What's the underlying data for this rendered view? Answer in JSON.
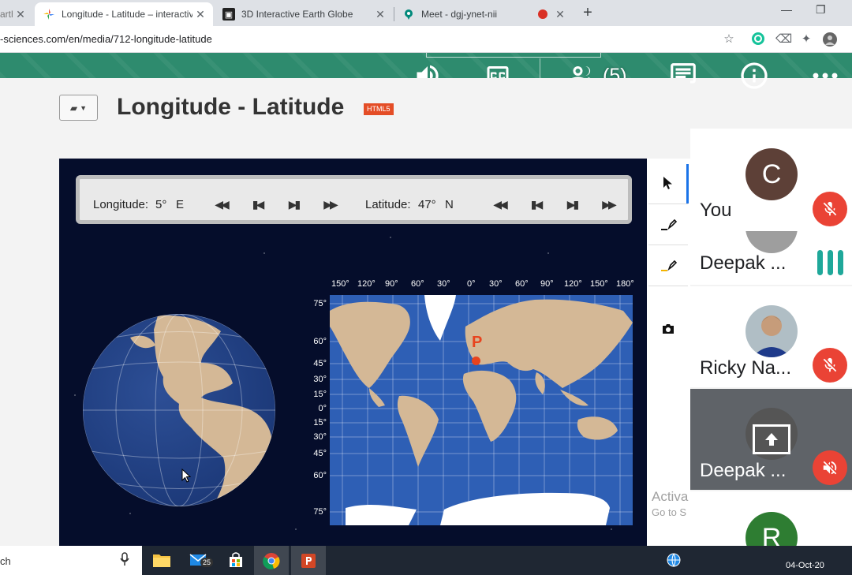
{
  "browser": {
    "tabs": [
      {
        "title": "arth",
        "favicon": "earth-icon"
      },
      {
        "title": "Longitude - Latitude – interactiv",
        "favicon": "pinwheel-icon",
        "active": true
      },
      {
        "title": "3D Interactive Earth Globe",
        "favicon": "globe-app-icon"
      },
      {
        "title": "Meet - dgj-ynet-nii",
        "favicon": "meet-icon"
      }
    ],
    "new_tab_label": "+",
    "url": "-sciences.com/en/media/712-longitude-latitude"
  },
  "meet": {
    "participants_count": "(5)"
  },
  "page": {
    "title": "Longitude - Latitude",
    "badge": "HTML5"
  },
  "simulation": {
    "longitude_label": "Longitude:",
    "longitude_value": "5°",
    "longitude_dir": "E",
    "latitude_label": "Latitude:",
    "latitude_value": "47°",
    "latitude_dir": "N",
    "marker_label": "P",
    "lon_ticks": [
      "150°",
      "120°",
      "90°",
      "60°",
      "30°",
      "0°",
      "30°",
      "60°",
      "90°",
      "120°",
      "150°",
      "180°"
    ],
    "lat_ticks": [
      "75°",
      "60°",
      "45°",
      "30°",
      "15°",
      "0°",
      "15°",
      "30°",
      "45°",
      "60°",
      "75°"
    ]
  },
  "participants": [
    {
      "name": "You",
      "initial": "C",
      "avatar_color": "#5d4037",
      "muted": true
    },
    {
      "name": "Deepak ...",
      "speaking": true
    },
    {
      "name": "Ricky Na...",
      "muted": true
    },
    {
      "name": "Deepak ...",
      "presenting": true,
      "muted": true
    },
    {
      "initial": "R",
      "avatar_color": "#2e7d32"
    }
  ],
  "watermark": {
    "line1": "Activa",
    "line2": "Go to S"
  },
  "taskbar": {
    "search_text": "ch",
    "mail_badge": "25",
    "date": "04-Oct-20"
  }
}
